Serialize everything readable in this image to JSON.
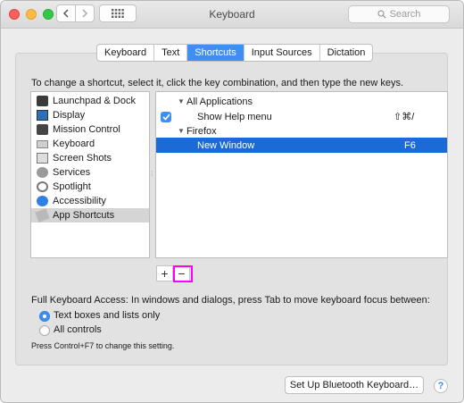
{
  "window": {
    "title": "Keyboard"
  },
  "toolbar": {
    "search_placeholder": "Search"
  },
  "tabs": [
    {
      "label": "Keyboard",
      "active": false
    },
    {
      "label": "Text",
      "active": false
    },
    {
      "label": "Shortcuts",
      "active": true
    },
    {
      "label": "Input Sources",
      "active": false
    },
    {
      "label": "Dictation",
      "active": false
    }
  ],
  "instructions": "To change a shortcut, select it, click the key combination, and then type the new keys.",
  "categories": [
    {
      "label": "Launchpad & Dock",
      "icon": "launchpad-icon"
    },
    {
      "label": "Display",
      "icon": "display-icon"
    },
    {
      "label": "Mission Control",
      "icon": "mission-control-icon"
    },
    {
      "label": "Keyboard",
      "icon": "keyboard-icon"
    },
    {
      "label": "Screen Shots",
      "icon": "screenshot-icon"
    },
    {
      "label": "Services",
      "icon": "gear-icon"
    },
    {
      "label": "Spotlight",
      "icon": "spotlight-icon"
    },
    {
      "label": "Accessibility",
      "icon": "accessibility-icon"
    },
    {
      "label": "App Shortcuts",
      "icon": "app-shortcuts-icon",
      "selected": true
    }
  ],
  "shortcuts": {
    "group1": {
      "label": "All Applications"
    },
    "item1": {
      "label": "Show Help menu",
      "keys": "⇧⌘/",
      "checked": true
    },
    "group2": {
      "label": "Firefox"
    },
    "item2": {
      "label": "New Window",
      "keys": "F6",
      "selected": true
    }
  },
  "buttons": {
    "add": "+",
    "remove": "−"
  },
  "keyboard_access": {
    "label": "Full Keyboard Access: In windows and dialogs, press Tab to move keyboard focus between:",
    "option1": "Text boxes and lists only",
    "option2": "All controls",
    "hint": "Press Control+F7 to change this setting.",
    "selected": "option1"
  },
  "footer": {
    "bluetooth_button": "Set Up Bluetooth Keyboard…",
    "help": "?"
  }
}
